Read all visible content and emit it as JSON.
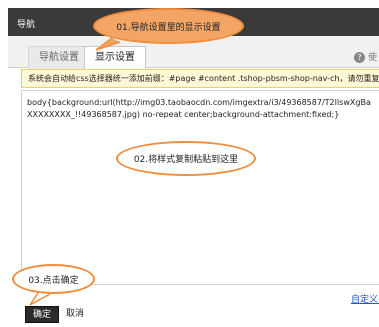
{
  "dialog": {
    "title": "导航"
  },
  "tabs": [
    {
      "label": "导航设置"
    },
    {
      "label": "显示设置"
    }
  ],
  "use_hint": "使",
  "notice": "系统会自动给css选择器统一添加前缀：#page #content .tshop-pbsm-shop-nav-ch，请勿重复添加!",
  "editor": {
    "code": "body{background:url(http://img03.taobaocdn.com/imgextra/i3/49368587/T2IlswXgBaXXXXXXXX_!!49368587.jpg) no-repeat center;background-attachment:fixed;}"
  },
  "custom_link": "自定义导",
  "buttons": {
    "ok": "确定",
    "cancel": "取消"
  },
  "callouts": {
    "step1": "01.导航设置里的显示设置",
    "step2": "02.将样式复制粘贴到这里",
    "step3": "03.点击确定"
  },
  "colors": {
    "titlebar": "#3a3a3a",
    "callout_border": "#f08d3c",
    "callout_fill": "#f3a566",
    "notice_bg": "#fff8d6"
  }
}
